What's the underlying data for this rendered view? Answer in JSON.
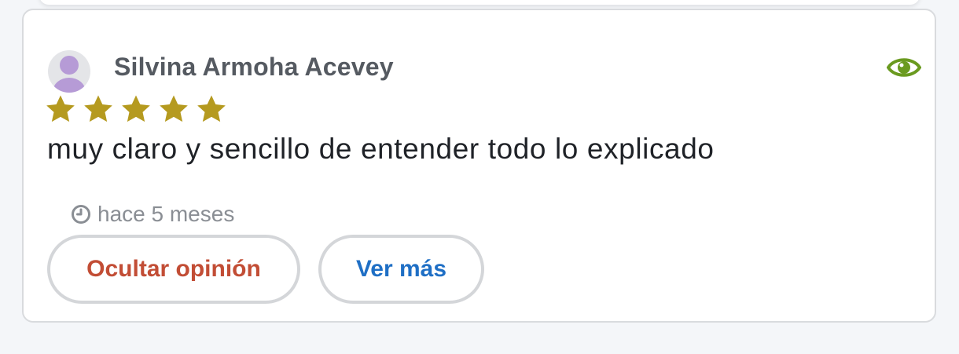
{
  "review": {
    "author_name": "Silvina Armoha Acevey",
    "avatar_icon": "user-avatar-icon",
    "visibility_icon": "eye-icon",
    "rating": 5,
    "rating_max": 5,
    "text": "muy claro y sencillo de entender todo lo explicado",
    "time_icon": "clock-icon",
    "time_ago": "hace 5 meses",
    "hide_button_label": "Ocultar opinión",
    "more_button_label": "Ver más"
  },
  "colors": {
    "star": "#b59a1f",
    "eye": "#6a9a1f",
    "hide_text": "#c24d35",
    "more_text": "#1f6fc5",
    "avatar": "#b69bd6"
  }
}
